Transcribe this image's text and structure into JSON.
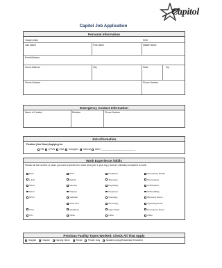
{
  "logo": {
    "text": "Capitol"
  },
  "title": "Capitol Job Application",
  "personal": {
    "heading": "Personal Information",
    "todays_date": "Today's Date",
    "ssn": "SSN",
    "last_name": "Last Name",
    "first_name": "First Name",
    "middle_name": "Middle Name",
    "email": "Email Address",
    "home_address": "Home Address",
    "city": "City",
    "state": "State",
    "zip": "Zip",
    "phone": "Phone Number",
    "phone2": "Phone Number"
  },
  "emergency": {
    "heading": "Emergency Contact Information",
    "name": "Name of Contact",
    "relation": "Relation",
    "phone": "Phone Number"
  },
  "job": {
    "heading": "Job Information",
    "position_label": "Position (Job Class) Applying for:",
    "options": [
      "RN",
      "LP/VN",
      "CNA",
      "Caregiver",
      "Clerical",
      "Other"
    ],
    "other_line": "___________________________"
  },
  "skills": {
    "heading": "Work Experience /Skills",
    "instructions": "Please list the number of years you have experience in each area (min 1 year exp.) and are clinically competent to work:",
    "col1": [
      "Burn",
      "L & D",
      "NICU",
      "NICU",
      "PICU",
      "CCU",
      "ICU"
    ],
    "col2": [
      "ENT",
      "Rehab",
      "Nursery",
      "Dialysis",
      "Geriatric",
      "Peds ICU",
      "Med/Surg",
      "Other"
    ],
    "col3": [
      "Pediatrics",
      "Telemetry",
      "Psychiatry",
      "Stepdown",
      "Oncology",
      "Neurology",
      "Open Heart",
      "Other"
    ],
    "col4": [
      "Detox/Drug Rehab",
      "Post-partum",
      "Orthopedics",
      "Mother/Baby",
      "Recovery Room",
      "Operating Room",
      "Emergency Room",
      "Other"
    ]
  },
  "facility": {
    "heading": "Previous Facility Types Worked: Check All That Apply",
    "items": [
      "Hospital",
      "Hospice",
      "Nursing Home",
      "Rehab",
      "Private Duty",
      "Assisted Living/Residential Treatment"
    ]
  }
}
